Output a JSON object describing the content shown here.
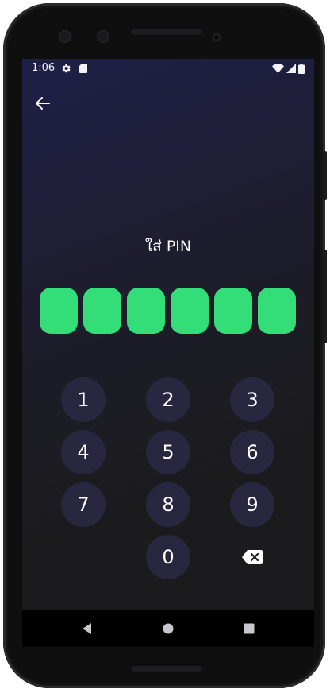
{
  "status_bar": {
    "time": "1:06",
    "icons": [
      "gear-icon",
      "sd-card-icon",
      "wifi-icon",
      "signal-icon",
      "battery-icon"
    ]
  },
  "header": {
    "back_icon": "arrow-left-icon"
  },
  "title": "ใส่ PIN",
  "pin": {
    "length": 6,
    "filled": 6,
    "color": "#33de79"
  },
  "keypad": {
    "keys": [
      "1",
      "2",
      "3",
      "4",
      "5",
      "6",
      "7",
      "8",
      "9",
      "0"
    ],
    "delete_icon": "backspace-icon"
  },
  "nav_bar": {
    "icons": [
      "back-triangle-icon",
      "home-circle-icon",
      "recents-square-icon"
    ]
  },
  "colors": {
    "background_top": "#1f1f47",
    "background_bottom": "#1b1b1d",
    "key_bg": "#292640",
    "pin_fill": "#33de79"
  }
}
